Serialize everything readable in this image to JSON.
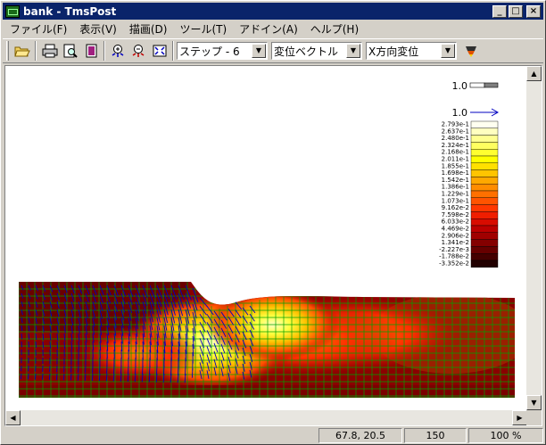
{
  "window": {
    "title": "bank - TmsPost",
    "minimize": "_",
    "maximize": "□",
    "close": "×"
  },
  "menu": [
    "ファイル(F)",
    "表示(V)",
    "描画(D)",
    "ツール(T)",
    "アドイン(A)",
    "ヘルプ(H)"
  ],
  "toolbar": {
    "buttons": [
      "open-icon",
      "print-icon",
      "print-preview-icon",
      "page-icon",
      "zoom-in-icon",
      "zoom-out-icon",
      "fit-icon",
      "palette-icon"
    ],
    "step_combo": "ステップ - 6",
    "mode_combo": "変位ベクトル",
    "component_combo": "X方向変位"
  },
  "plot": {
    "scale_bar_label": "1.0",
    "vector_scale_label": "1.0",
    "legend_values": [
      "2.793e-1",
      "2.637e-1",
      "2.480e-1",
      "2.324e-1",
      "2.168e-1",
      "2.011e-1",
      "1.855e-1",
      "1.698e-1",
      "1.542e-1",
      "1.386e-1",
      "1.229e-1",
      "1.073e-1",
      "9.162e-2",
      "7.598e-2",
      "6.033e-2",
      "4.469e-2",
      "2.906e-2",
      "1.341e-2",
      "-2.227e-3",
      "-1.788e-2",
      "-3.352e-2"
    ],
    "legend_colors": [
      "#fffff0",
      "#ffffc0",
      "#ffff90",
      "#ffff60",
      "#ffff30",
      "#ffff00",
      "#ffe000",
      "#ffc400",
      "#ffa800",
      "#ff8c00",
      "#ff7000",
      "#ff5400",
      "#ff3800",
      "#f01e00",
      "#d80c00",
      "#bc0000",
      "#a00000",
      "#840000",
      "#660000",
      "#440000",
      "#220000"
    ],
    "mesh_color": "#00a000",
    "vector_color": "#0000c0"
  },
  "status": {
    "coords": "67.8, 20.5",
    "value": "150",
    "zoom": "100 %"
  }
}
